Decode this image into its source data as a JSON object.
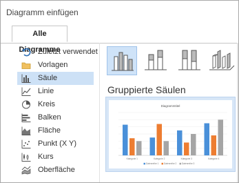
{
  "window": {
    "title": "Diagramm einfügen"
  },
  "tabs": [
    {
      "label": "Alle Diagramme"
    }
  ],
  "sidebar": {
    "items": [
      {
        "label": "Zuletzt verwendet",
        "icon": "recent-arrow-icon"
      },
      {
        "label": "Vorlagen",
        "icon": "folder-icon"
      },
      {
        "label": "Säule",
        "icon": "column-chart-icon",
        "selected": true
      },
      {
        "label": "Linie",
        "icon": "line-chart-icon"
      },
      {
        "label": "Kreis",
        "icon": "pie-chart-icon"
      },
      {
        "label": "Balken",
        "icon": "bar-chart-icon"
      },
      {
        "label": "Fläche",
        "icon": "area-chart-icon"
      },
      {
        "label": "Punkt (X Y)",
        "icon": "scatter-chart-icon"
      },
      {
        "label": "Kurs",
        "icon": "stock-chart-icon"
      },
      {
        "label": "Oberfläche",
        "icon": "surface-chart-icon"
      }
    ]
  },
  "subtypes": [
    {
      "name": "clustered-column",
      "selected": true
    },
    {
      "name": "stacked-column"
    },
    {
      "name": "100-stacked-column"
    },
    {
      "name": "3d-column"
    }
  ],
  "main": {
    "heading": "Gruppierte Säulen"
  },
  "colors": {
    "accent_selected": "#cde1f6",
    "series1": "#4a90d9",
    "series2": "#ed7d31",
    "series3": "#a5a5a5"
  },
  "chart_data": {
    "type": "bar",
    "title": "Diagrammtitel",
    "categories": [
      "Kategorie 1",
      "Kategorie 2",
      "Kategorie 3",
      "Kategorie 4"
    ],
    "series": [
      {
        "name": "Datenreihe 1",
        "values": [
          4.3,
          2.5,
          3.5,
          4.5
        ]
      },
      {
        "name": "Datenreihe 2",
        "values": [
          2.4,
          4.4,
          1.8,
          2.8
        ]
      },
      {
        "name": "Datenreihe 3",
        "values": [
          2.0,
          2.0,
          3.0,
          5.0
        ]
      }
    ],
    "ylim": [
      0,
      6
    ],
    "grid": true,
    "legend": "bottom"
  }
}
